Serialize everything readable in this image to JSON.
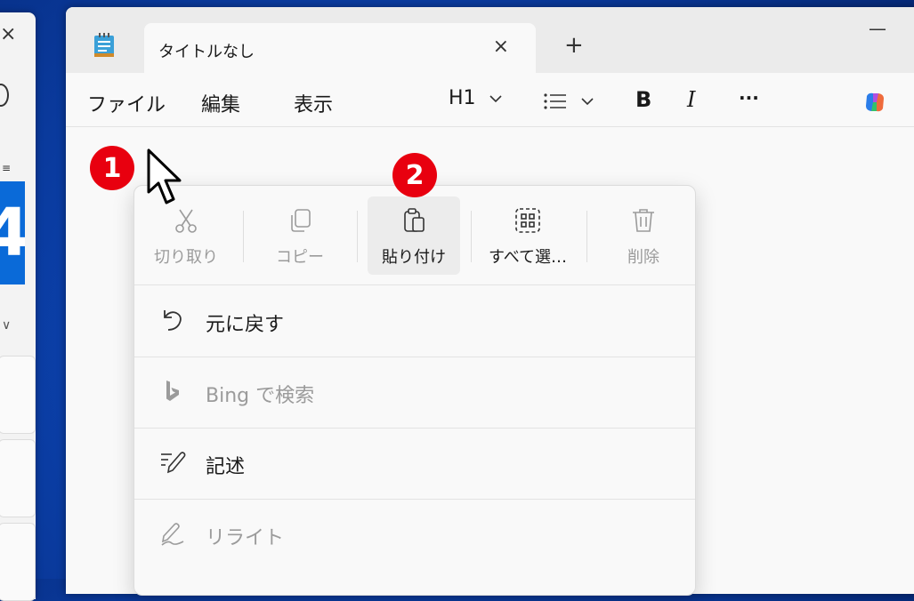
{
  "background": {
    "color": "#0b3fa8"
  },
  "bg_window": {
    "close_glyph": "×",
    "tile_text": "4",
    "small_text": "≡",
    "chevron": "∨"
  },
  "window": {
    "tab_title": "タイトルなし",
    "tab_close": "×",
    "new_tab": "+",
    "minimize": "—"
  },
  "menubar": {
    "file": "ファイル",
    "edit": "編集",
    "view": "表示",
    "heading": "H1",
    "bold": "B",
    "italic": "I",
    "more": "···"
  },
  "context_menu": {
    "commands": [
      {
        "label": "切り取り",
        "icon": "scissors-icon",
        "enabled": false
      },
      {
        "label": "コピー",
        "icon": "copy-icon",
        "enabled": false
      },
      {
        "label": "貼り付け",
        "icon": "paste-icon",
        "enabled": true,
        "highlighted": true
      },
      {
        "label": "すべて選…",
        "icon": "select-all-icon",
        "enabled": true
      },
      {
        "label": "削除",
        "icon": "trash-icon",
        "enabled": false
      }
    ],
    "items": [
      {
        "label": "元に戻す",
        "icon": "undo-icon",
        "enabled": true
      },
      {
        "label": "Bing で検索",
        "icon": "bing-icon",
        "enabled": false
      },
      {
        "label": "記述",
        "icon": "compose-icon",
        "enabled": true
      },
      {
        "label": "リライト",
        "icon": "rewrite-icon",
        "enabled": false
      }
    ]
  },
  "annotations": {
    "step1": "1",
    "step2": "2",
    "badge_color": "#e8000f"
  }
}
